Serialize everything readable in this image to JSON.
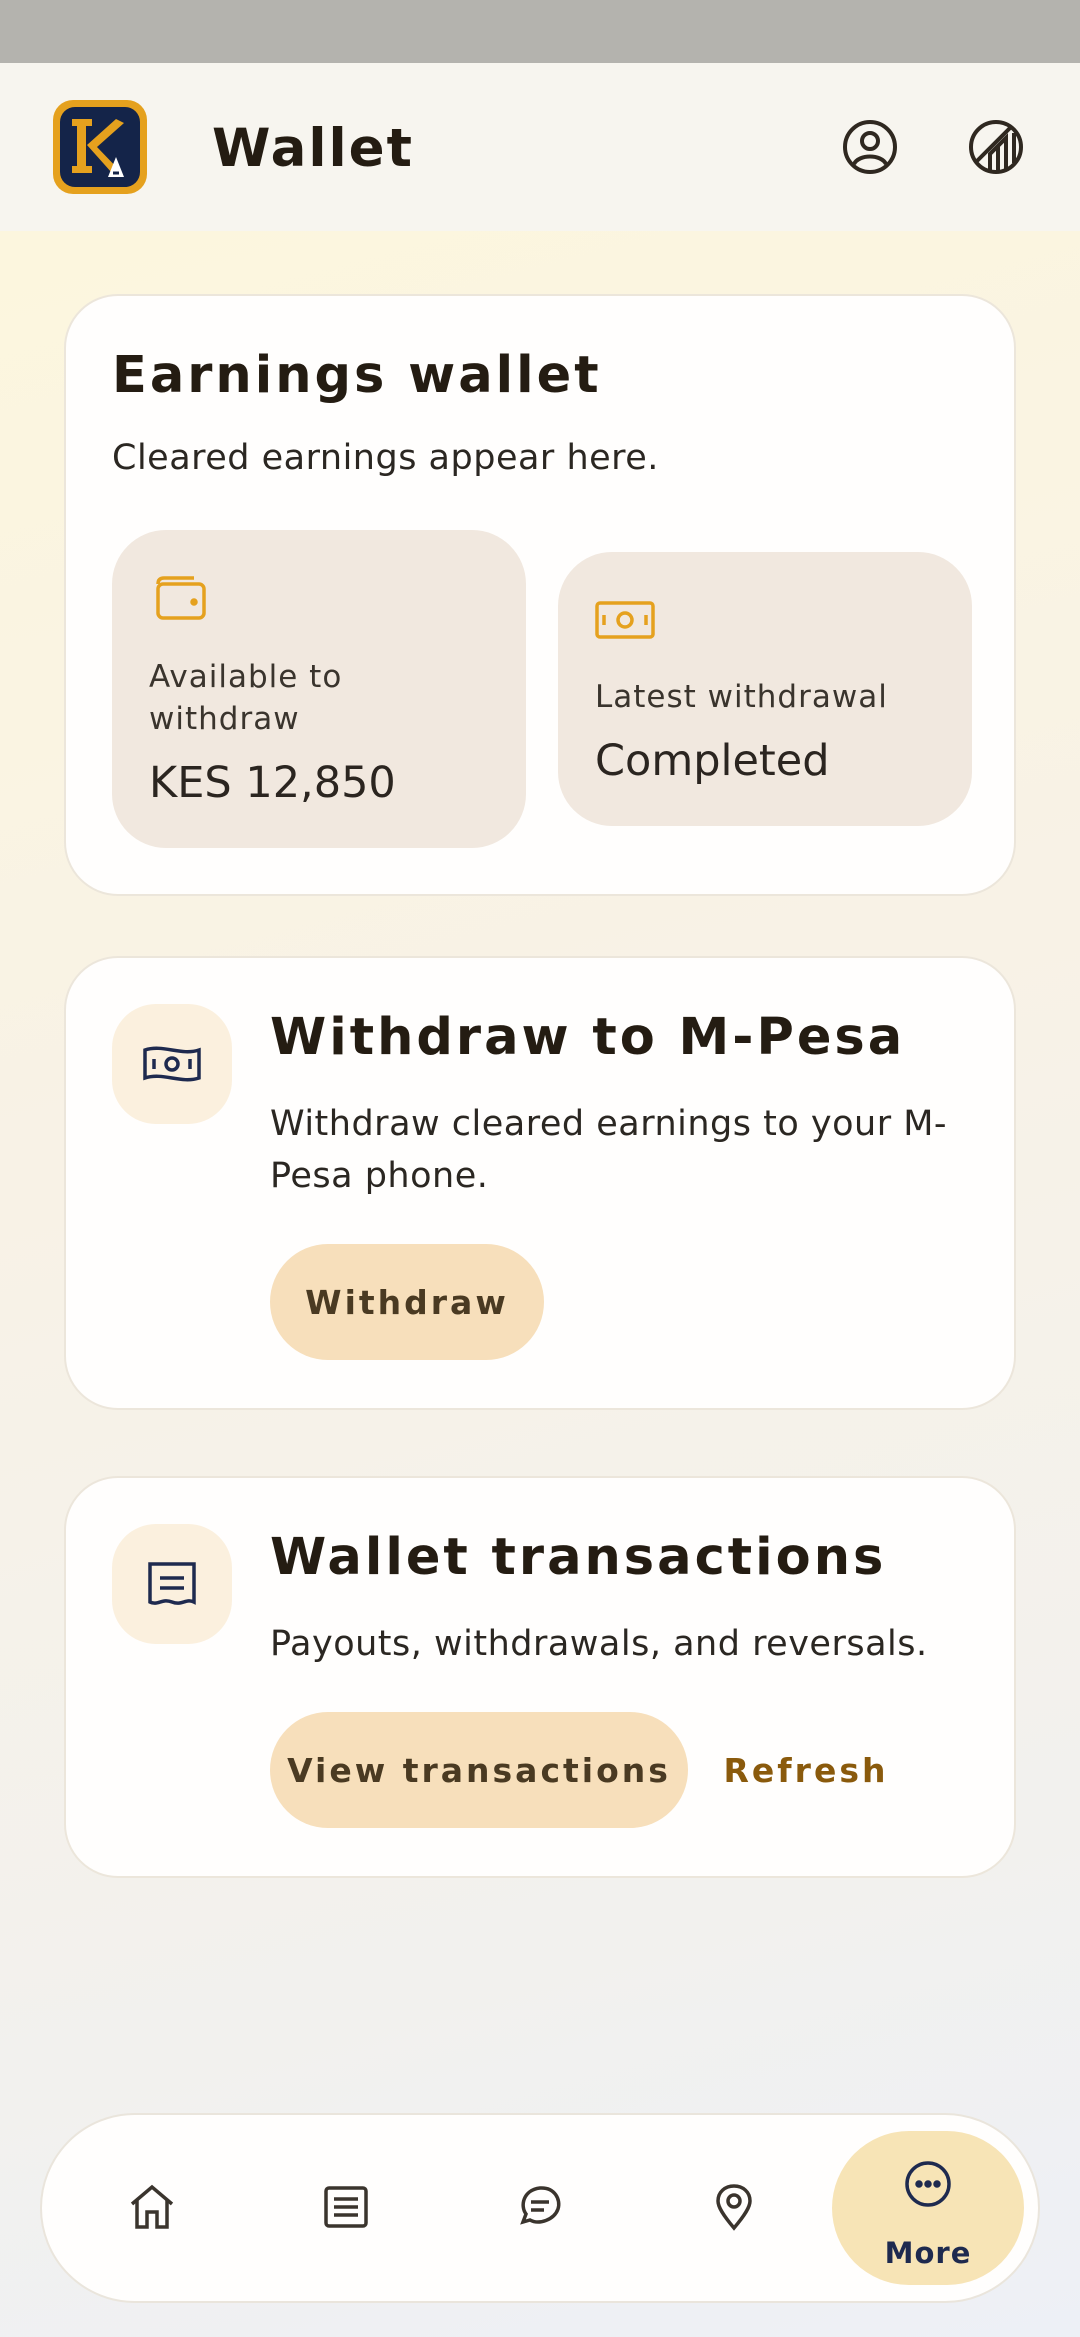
{
  "header": {
    "title": "Wallet",
    "logo_name": "KA app logo"
  },
  "earnings_card": {
    "title": "Earnings wallet",
    "subtitle": "Cleared earnings appear here.",
    "available": {
      "label": "Available to withdraw",
      "value": "KES 12,850",
      "icon": "wallet-icon"
    },
    "latest": {
      "label": "Latest withdrawal",
      "value": "Completed",
      "icon": "banknote-icon"
    }
  },
  "withdraw_card": {
    "title": "Withdraw to M-Pesa",
    "subtitle": "Withdraw cleared earnings to your M-Pesa phone.",
    "button": "Withdraw",
    "icon": "banknote-icon"
  },
  "transactions_card": {
    "title": "Wallet transactions",
    "subtitle": "Payouts, withdrawals, and reversals.",
    "primary_button": "View transactions",
    "secondary_button": "Refresh",
    "icon": "receipt-icon"
  },
  "nav": {
    "items": [
      {
        "icon": "home-icon"
      },
      {
        "icon": "list-icon"
      },
      {
        "icon": "chat-icon"
      },
      {
        "icon": "location-pin-icon"
      },
      {
        "icon": "more-icon",
        "label": "More",
        "active": true
      }
    ]
  },
  "colors": {
    "accent": "#e5a11e",
    "navy": "#1e2a4f",
    "button_fill": "#f7dfbb",
    "text_link": "#8a5a0c"
  }
}
